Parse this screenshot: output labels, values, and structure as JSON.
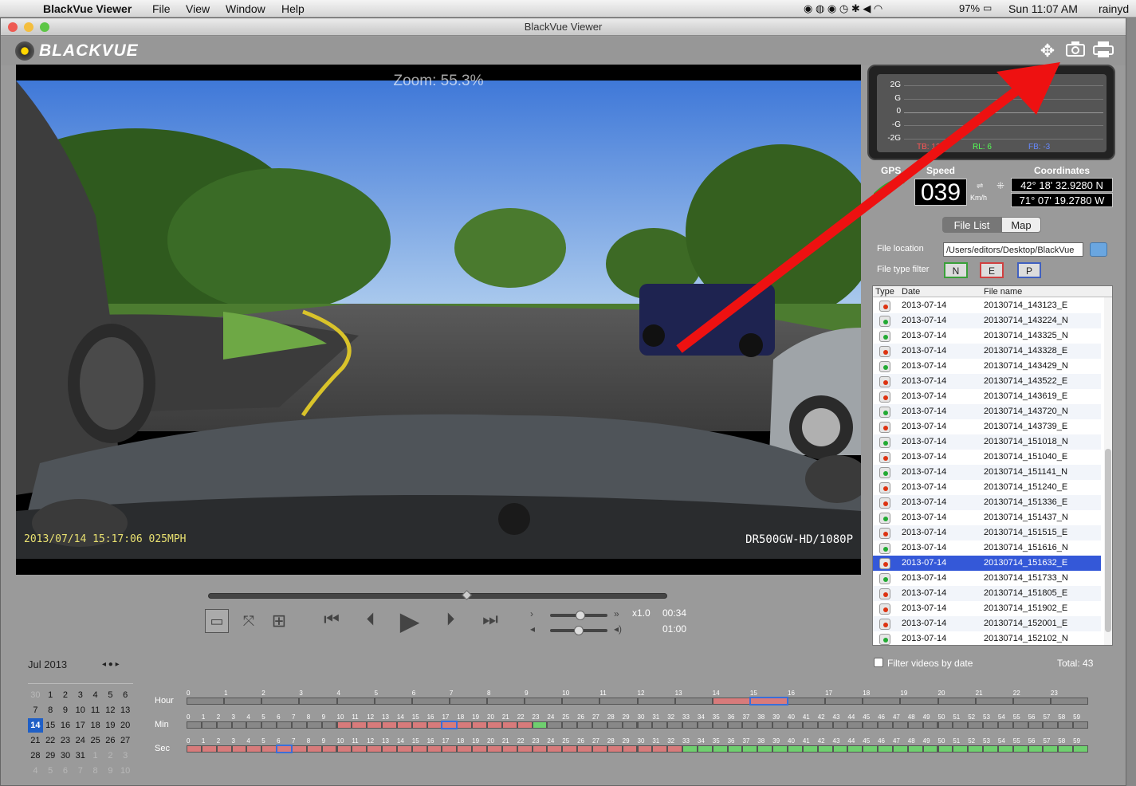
{
  "menubar": {
    "app_name": "BlackVue Viewer",
    "menus": [
      "File",
      "View",
      "Window",
      "Help"
    ],
    "battery": "97%",
    "clock": "Sun 11:07 AM",
    "user": "rainyd"
  },
  "window": {
    "title": "BlackVue Viewer"
  },
  "brand": {
    "logo_text": "BLACKVUE"
  },
  "video": {
    "zoom_text": "Zoom: 55.3%",
    "overlay_timestamp": "2013/07/14 15:17:06  025MPH",
    "overlay_model": "DR500GW-HD/1080P"
  },
  "playback": {
    "speed_label": "x1.0",
    "current_time": "00:34",
    "total_time": "01:00",
    "seek_fraction": 0.56
  },
  "gsensor": {
    "y_labels": [
      "2G",
      "G",
      "0",
      "-G",
      "-2G"
    ],
    "tb": "TB: 12",
    "rl": "RL: 6",
    "fb": "FB: -3",
    "colors": {
      "tb": "#ff4444",
      "rl": "#44ff44",
      "fb": "#4466ff"
    }
  },
  "gps": {
    "gps_label": "GPS",
    "speed_label": "Speed",
    "speed_value": "039",
    "speed_unit": "Km/h",
    "coords_label": "Coordinates",
    "lat": "42° 18' 32.9280 N",
    "lon": "71° 07' 19.2780 W"
  },
  "tabs": {
    "file_list": "File List",
    "map": "Map"
  },
  "file_location": {
    "label": "File location",
    "value": "/Users/editors/Desktop/BlackVue"
  },
  "file_type_filter": {
    "label": "File type filter",
    "n": "N",
    "e": "E",
    "p": "P"
  },
  "filelist": {
    "headers": {
      "type": "Type",
      "date": "Date",
      "name": "File name"
    },
    "rows": [
      {
        "type": "E",
        "date": "2013-07-14",
        "name": "20130714_143123_E"
      },
      {
        "type": "N",
        "date": "2013-07-14",
        "name": "20130714_143224_N"
      },
      {
        "type": "N",
        "date": "2013-07-14",
        "name": "20130714_143325_N"
      },
      {
        "type": "E",
        "date": "2013-07-14",
        "name": "20130714_143328_E"
      },
      {
        "type": "N",
        "date": "2013-07-14",
        "name": "20130714_143429_N"
      },
      {
        "type": "E",
        "date": "2013-07-14",
        "name": "20130714_143522_E"
      },
      {
        "type": "E",
        "date": "2013-07-14",
        "name": "20130714_143619_E"
      },
      {
        "type": "N",
        "date": "2013-07-14",
        "name": "20130714_143720_N"
      },
      {
        "type": "E",
        "date": "2013-07-14",
        "name": "20130714_143739_E"
      },
      {
        "type": "N",
        "date": "2013-07-14",
        "name": "20130714_151018_N"
      },
      {
        "type": "E",
        "date": "2013-07-14",
        "name": "20130714_151040_E"
      },
      {
        "type": "N",
        "date": "2013-07-14",
        "name": "20130714_151141_N"
      },
      {
        "type": "E",
        "date": "2013-07-14",
        "name": "20130714_151240_E"
      },
      {
        "type": "E",
        "date": "2013-07-14",
        "name": "20130714_151336_E"
      },
      {
        "type": "N",
        "date": "2013-07-14",
        "name": "20130714_151437_N"
      },
      {
        "type": "E",
        "date": "2013-07-14",
        "name": "20130714_151515_E"
      },
      {
        "type": "N",
        "date": "2013-07-14",
        "name": "20130714_151616_N"
      },
      {
        "type": "E",
        "date": "2013-07-14",
        "name": "20130714_151632_E",
        "selected": true
      },
      {
        "type": "N",
        "date": "2013-07-14",
        "name": "20130714_151733_N"
      },
      {
        "type": "E",
        "date": "2013-07-14",
        "name": "20130714_151805_E"
      },
      {
        "type": "E",
        "date": "2013-07-14",
        "name": "20130714_151902_E"
      },
      {
        "type": "E",
        "date": "2013-07-14",
        "name": "20130714_152001_E"
      },
      {
        "type": "N",
        "date": "2013-07-14",
        "name": "20130714_152102_N"
      }
    ],
    "filter_by_date_label": "Filter videos by date",
    "total": "Total: 43"
  },
  "calendar": {
    "month": "Jul 2013",
    "days": [
      "30",
      "1",
      "2",
      "3",
      "4",
      "5",
      "6",
      "7",
      "8",
      "9",
      "10",
      "11",
      "12",
      "13",
      "14",
      "15",
      "16",
      "17",
      "18",
      "19",
      "20",
      "21",
      "22",
      "23",
      "24",
      "25",
      "26",
      "27",
      "28",
      "29",
      "30",
      "31",
      "1",
      "2",
      "3",
      "4",
      "5",
      "6",
      "7",
      "8",
      "9",
      "10"
    ],
    "dim_indices": [
      0,
      32,
      33,
      34,
      35,
      36,
      37,
      38,
      39,
      40,
      41
    ],
    "selected_index": 14
  },
  "timeline": {
    "hour_label": "Hour",
    "min_label": "Min",
    "sec_label": "Sec"
  }
}
